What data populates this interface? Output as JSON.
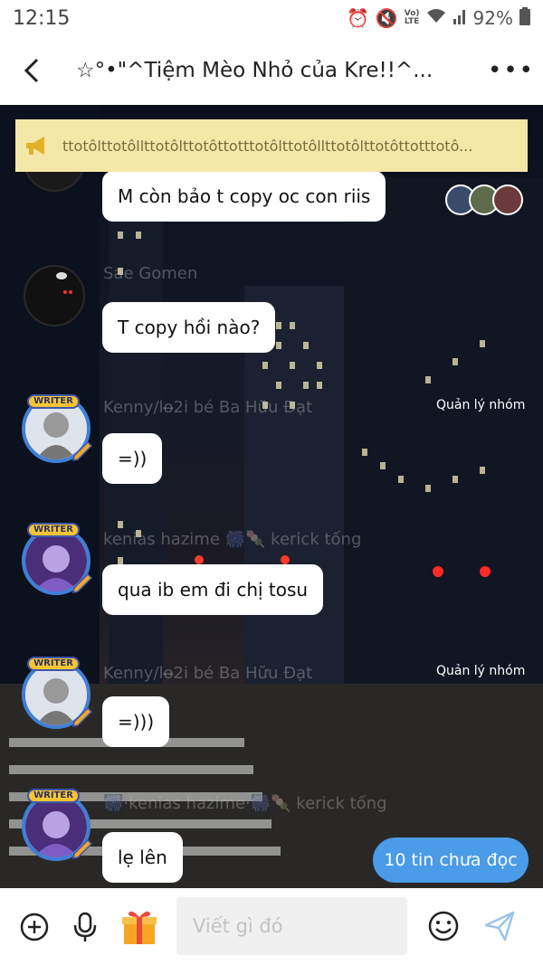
{
  "status_bar": {
    "time": "12:15",
    "network_label_top": "Vo)",
    "network_label_bottom": "LTE",
    "battery": "92%"
  },
  "header": {
    "title": "☆°•\"^Tiệm Mèo Nhỏ của Kre!!^...",
    "back_icon": "chevron-left-icon",
    "more_icon": "more-dots-icon"
  },
  "announcement": {
    "text": "ttotôlttotôllttotôlttotôttotttotôlttotôllttotôlttotôttotttotô..."
  },
  "messages": [
    {
      "text": "M còn bảo t copy oc con riis"
    },
    {
      "name": "Sae Gomen",
      "text": "T copy hồi nào?"
    },
    {
      "name": "Kenny/lo̶2i bé Ba Hữu Đạt",
      "role": "Quản lý nhóm",
      "text": "=))"
    },
    {
      "name": "kenias hazime 🎆🍡 kerick tống",
      "text": "qua ib em đi chị tosu"
    },
    {
      "name": "Kenny/lo̶2i bé Ba Hữu Đạt",
      "role": "Quản lý nhóm",
      "text": "=)))"
    },
    {
      "name": "🎆·kenias hazime·🎆🍡 kerick tống",
      "text": "lẹ lên"
    }
  ],
  "badges": {
    "writer": "WRITER"
  },
  "unread_button": "10 tin chưa đọc",
  "input": {
    "placeholder": "Viết gì đó"
  },
  "colors": {
    "accent": "#4a9be8",
    "announcement_bg": "#f5e7a6",
    "writer_ring": "#3f7fd6"
  }
}
